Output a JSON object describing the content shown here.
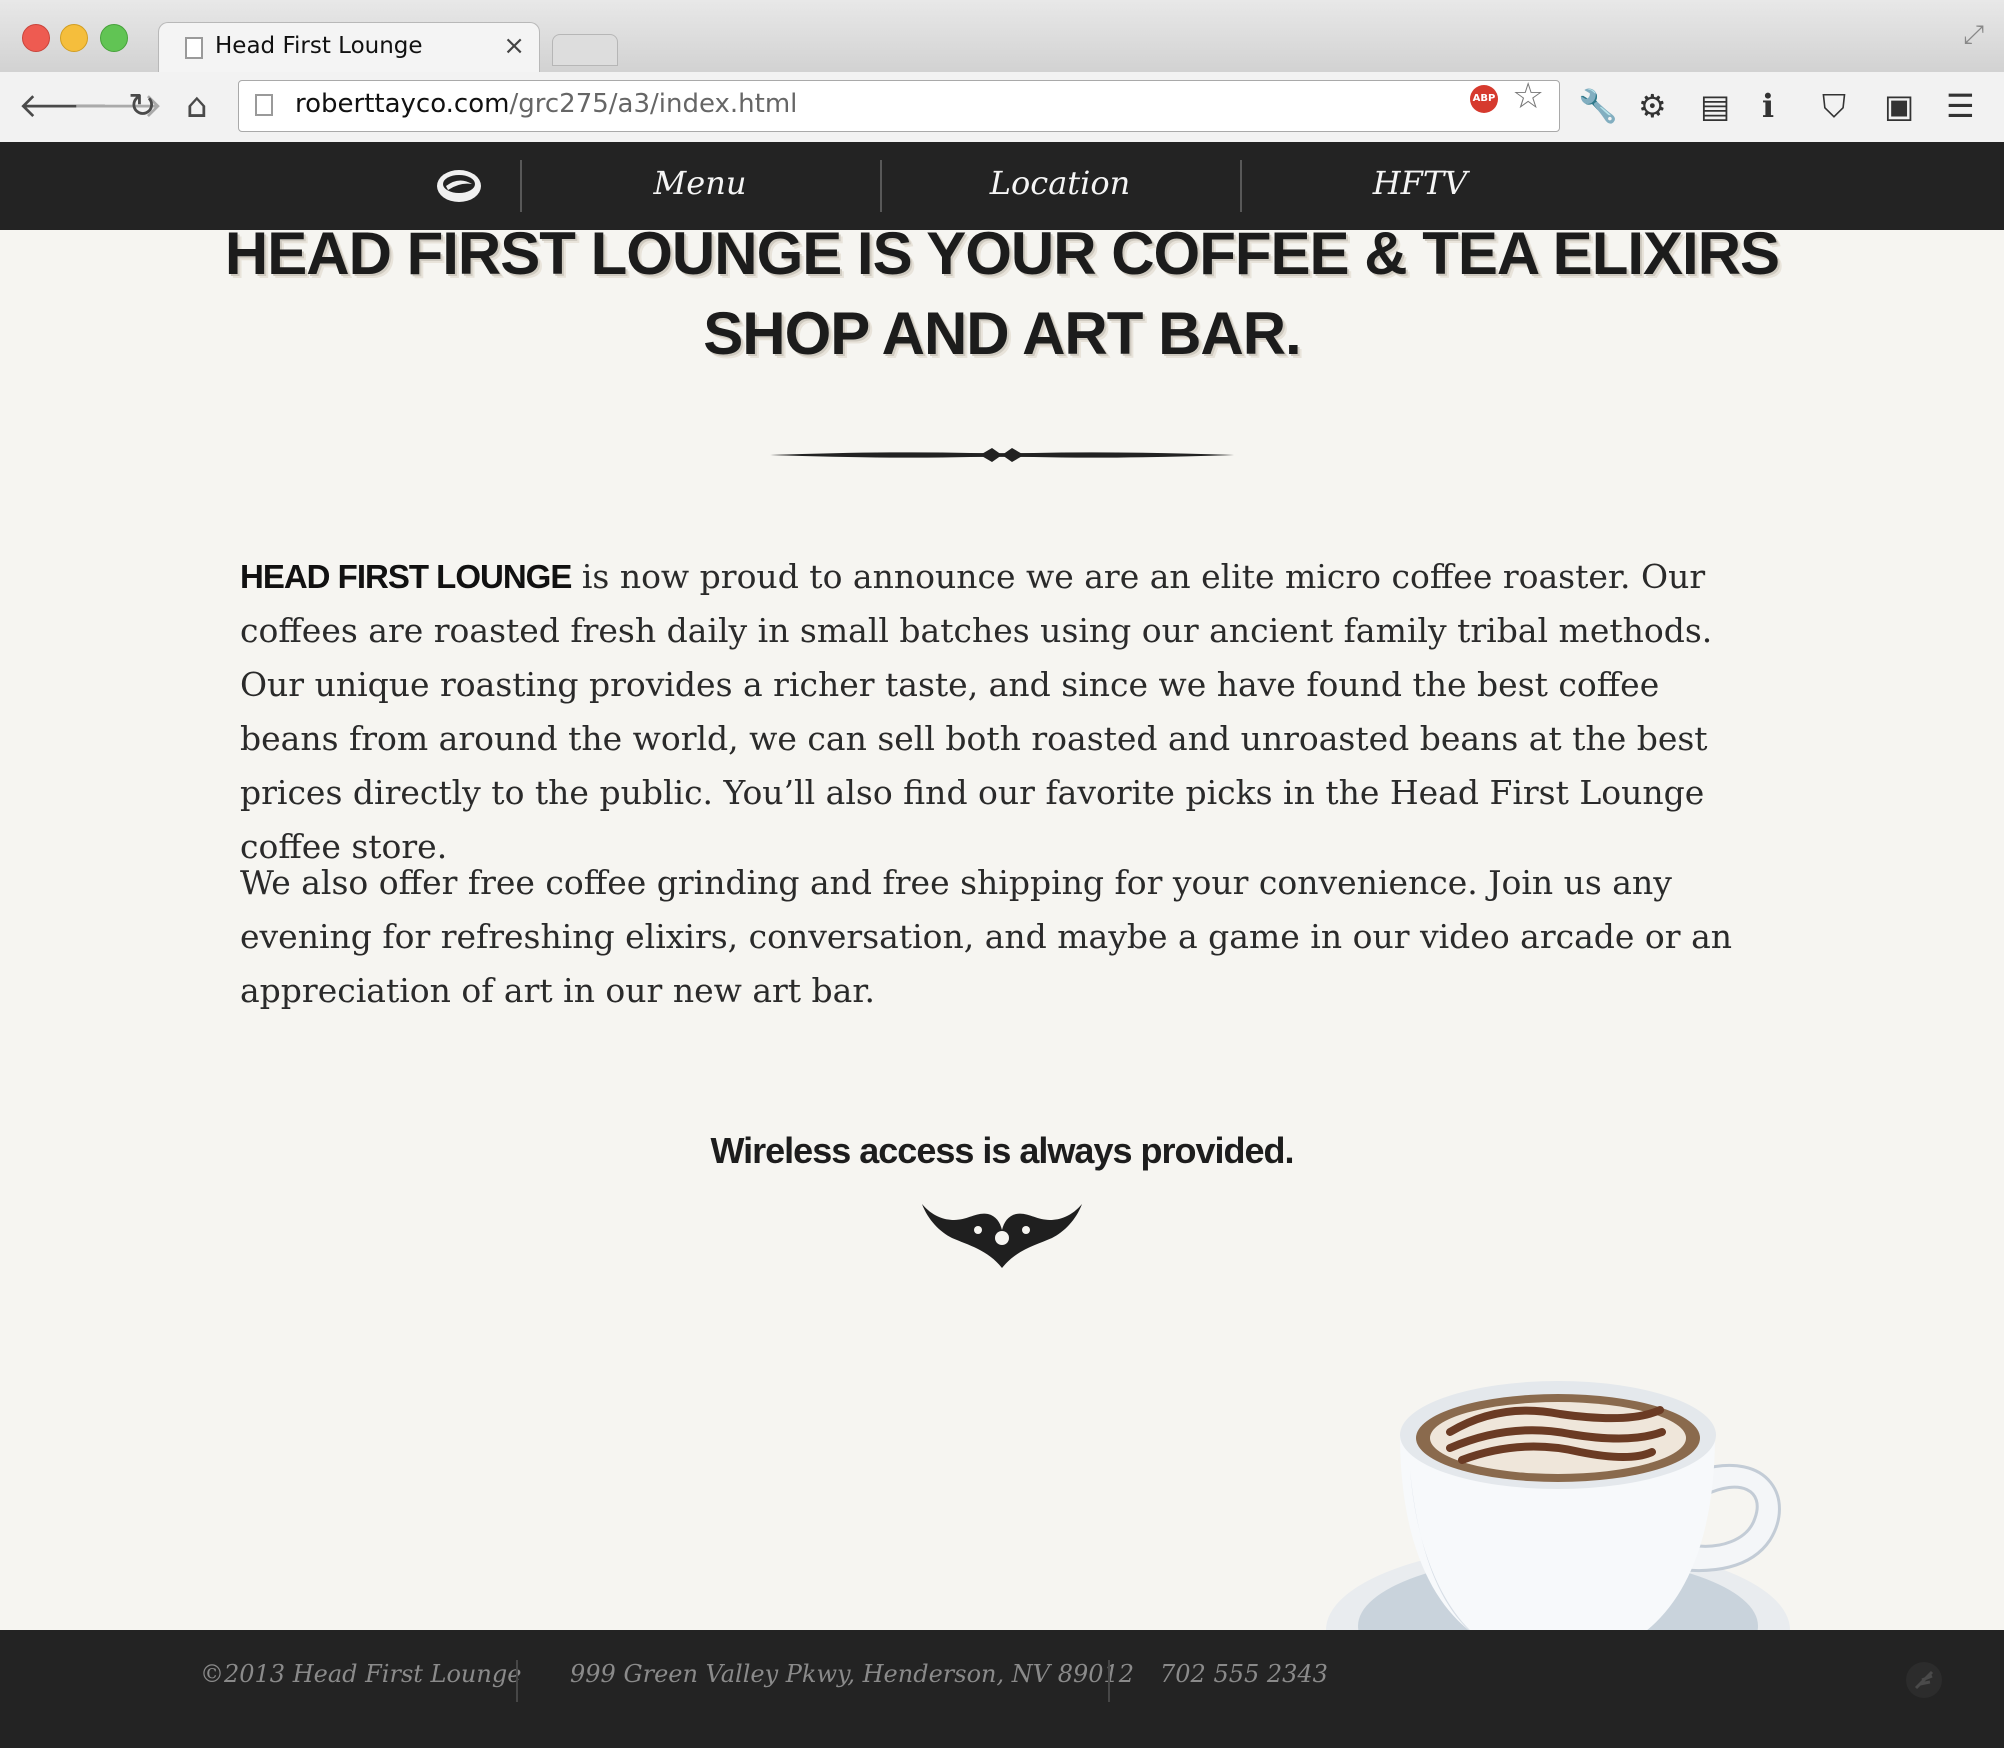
{
  "browser": {
    "tab_title": "Head First Lounge",
    "tab_close": "×",
    "url_domain": "roberttayco.com",
    "url_path": "/grc275/a3/index.html",
    "abp_label": "ABP"
  },
  "nav": {
    "items": [
      {
        "label": "Menu"
      },
      {
        "label": "Location"
      },
      {
        "label": "HFTV"
      }
    ]
  },
  "content": {
    "headline": "HEAD FIRST LOUNGE IS YOUR COFFEE & TEA ELIXIRS SHOP AND ART BAR.",
    "para1_lead": "HEAD FIRST LOUNGE",
    "para1_rest": " is now proud to announce we are an elite micro coffee roaster. Our coffees are roasted fresh daily in small batches using our ancient family tribal methods. Our unique roasting provides a richer taste, and since we have found the best coffee beans from around the world, we can sell both roasted and unroasted beans at the best prices directly to the public. You’ll also find our favorite picks in the Head First Lounge coffee store.",
    "para2": "We also offer free coffee grinding and free shipping for your convenience. Join us any evening for refreshing elixirs, conversation, and maybe a game in our video arcade or an appreciation of art in our new art bar.",
    "wireless": "Wireless access is always provided."
  },
  "footer": {
    "copyright": "©2013 Head First Lounge",
    "address": "999 Green Valley Pkwy, Henderson, NV 89012",
    "phone": "702 555 2343"
  },
  "colors": {
    "nav_bg": "#232323",
    "page_bg": "#f6f5f1",
    "text": "#2a2a2a"
  }
}
